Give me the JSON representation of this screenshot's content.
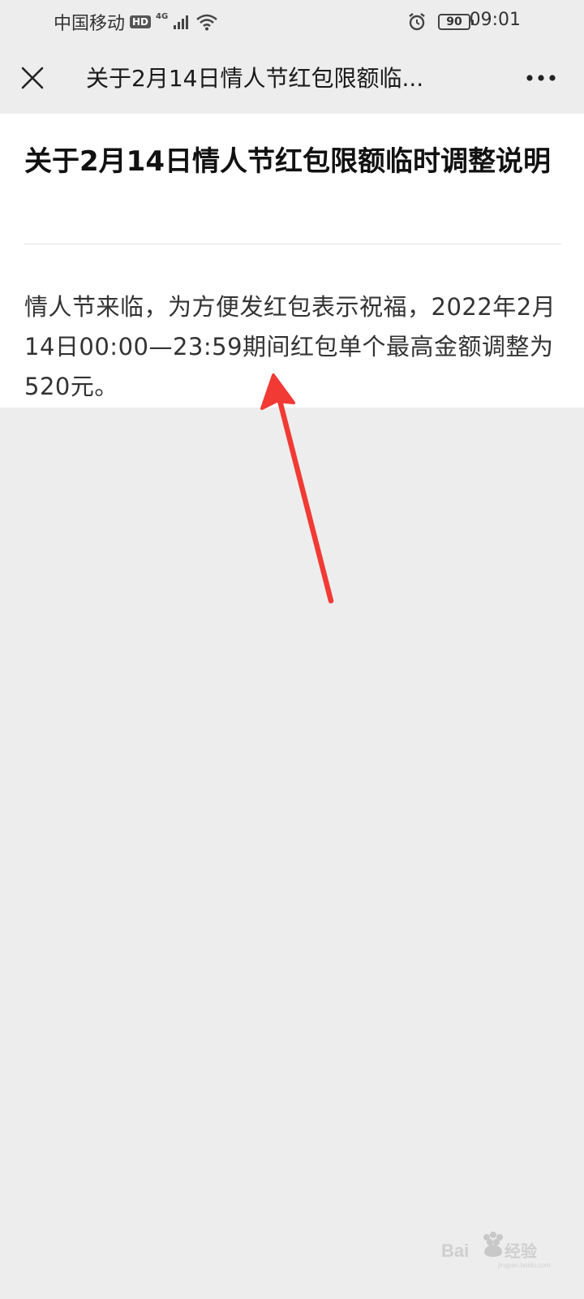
{
  "status_bar": {
    "carrier": "中国移动",
    "hd_badge": "HD",
    "network_type": "4G",
    "battery_level": "90",
    "time": "09:01",
    "icons": [
      "signal-icon",
      "wifi-icon",
      "alarm-icon",
      "battery-icon"
    ]
  },
  "nav": {
    "title": "关于2月14日情人节红包限额临...",
    "close_icon": "close-icon",
    "more_icon": "more-icon"
  },
  "article": {
    "title": "关于2月14日情人节红包限额临时调整说明",
    "body": "情人节来临，为方便发红包表示祝福，2022年2月14日00:00—23:59期间红包单个最高金额调整为520元。"
  },
  "annotation": {
    "color": "#f23a35",
    "icon": "red-arrow-icon"
  },
  "watermark": {
    "text": "Baidu经验",
    "subtext": "jingyan.baidu.com"
  },
  "colors": {
    "page_background": "#ededed",
    "card_background": "#ffffff",
    "title_text": "#111111",
    "body_text": "#333333"
  }
}
